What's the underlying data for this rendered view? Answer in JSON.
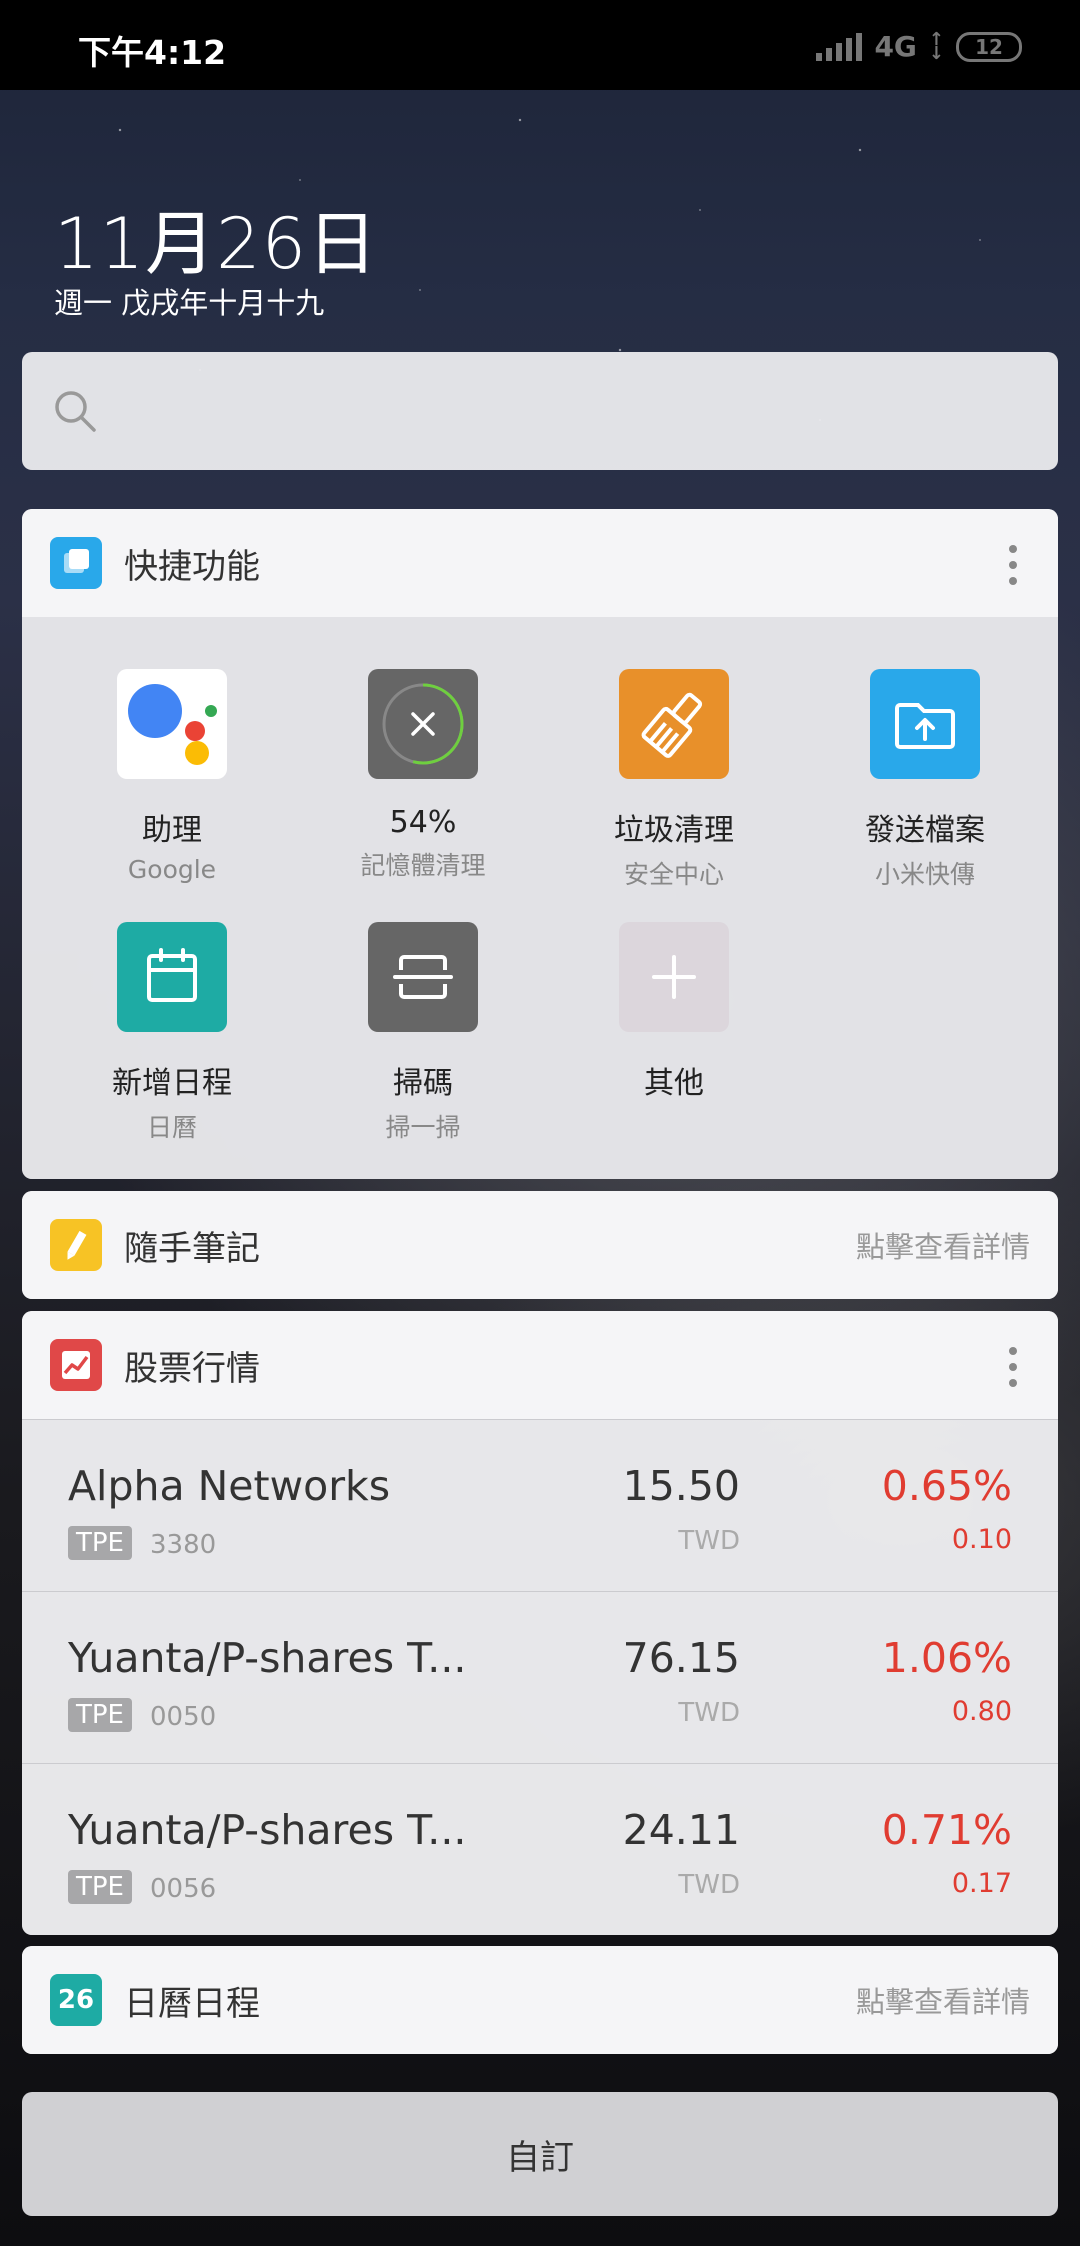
{
  "status_bar": {
    "time": "下午4:12",
    "network": "4G",
    "battery": "12"
  },
  "header": {
    "date": "11月26日",
    "lunar": "週一 戊戌年十月十九"
  },
  "search": {
    "placeholder": ""
  },
  "quick_functions": {
    "title": "快捷功能",
    "items": [
      {
        "label": "助理",
        "sub": "Google",
        "icon": "google-assistant-icon"
      },
      {
        "label": "54%",
        "sub": "記憶體清理",
        "icon": "memory-clean-icon"
      },
      {
        "label": "垃圾清理",
        "sub": "安全中心",
        "icon": "broom-icon"
      },
      {
        "label": "發送檔案",
        "sub": "小米快傳",
        "icon": "folder-upload-icon"
      },
      {
        "label": "新增日程",
        "sub": "日曆",
        "icon": "calendar-add-icon"
      },
      {
        "label": "掃碼",
        "sub": "掃一掃",
        "icon": "scan-icon"
      },
      {
        "label": "其他",
        "sub": "",
        "icon": "plus-icon"
      }
    ],
    "memory_percent": 54
  },
  "notes": {
    "title": "隨手筆記",
    "detail": "點擊查看詳情"
  },
  "stocks": {
    "title": "股票行情",
    "rows": [
      {
        "name": "Alpha Networks",
        "exchange": "TPE",
        "code": "3380",
        "price": "15.50",
        "currency": "TWD",
        "percent": "0.65%",
        "change": "0.10"
      },
      {
        "name": "Yuanta/P-shares T...",
        "exchange": "TPE",
        "code": "0050",
        "price": "76.15",
        "currency": "TWD",
        "percent": "1.06%",
        "change": "0.80"
      },
      {
        "name": "Yuanta/P-shares T...",
        "exchange": "TPE",
        "code": "0056",
        "price": "24.11",
        "currency": "TWD",
        "percent": "0.71%",
        "change": "0.17"
      }
    ]
  },
  "calendar": {
    "title": "日曆日程",
    "icon_text": "26",
    "detail": "點擊查看詳情"
  },
  "customize": {
    "label": "自訂"
  },
  "colors": {
    "up": "#e03c31",
    "accent_blue": "#29a8ea",
    "teal": "#1eaba4",
    "orange": "#e8902a"
  }
}
